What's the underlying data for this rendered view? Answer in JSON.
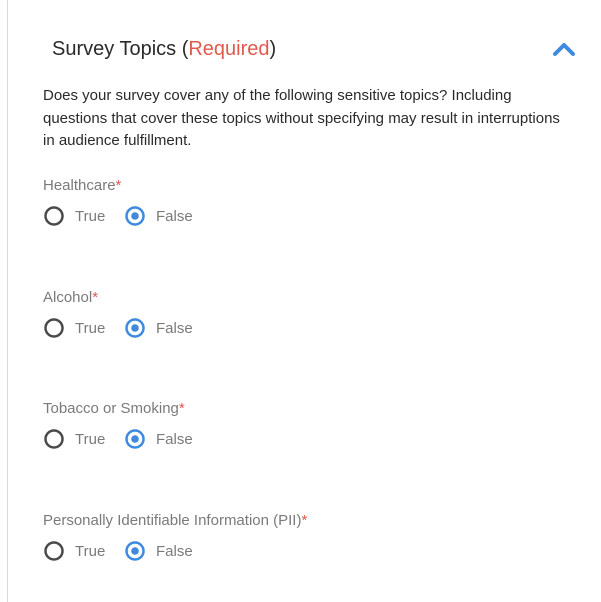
{
  "section": {
    "title": "Survey Topics (",
    "required": "Required",
    "title_close": ")",
    "description": "Does your survey cover any of the following sensitive topics? Including questions that cover these topics without specifying may result in interruptions in audience fulfillment."
  },
  "collapse_icon": "chevron-up-icon",
  "colors": {
    "accent": "#3d8ae0",
    "required": "#e05a4e",
    "text": "#2a2a2a",
    "muted": "#7a7a7a"
  },
  "questions": [
    {
      "label": "Healthcare",
      "required_mark": "*",
      "options": [
        "True",
        "False"
      ],
      "selected": "False"
    },
    {
      "label": "Alcohol",
      "required_mark": "*",
      "options": [
        "True",
        "False"
      ],
      "selected": "False"
    },
    {
      "label": "Tobacco or Smoking",
      "required_mark": "*",
      "options": [
        "True",
        "False"
      ],
      "selected": "False"
    },
    {
      "label": "Personally Identifiable Information (PII)",
      "required_mark": "*",
      "options": [
        "True",
        "False"
      ],
      "selected": "False"
    }
  ]
}
